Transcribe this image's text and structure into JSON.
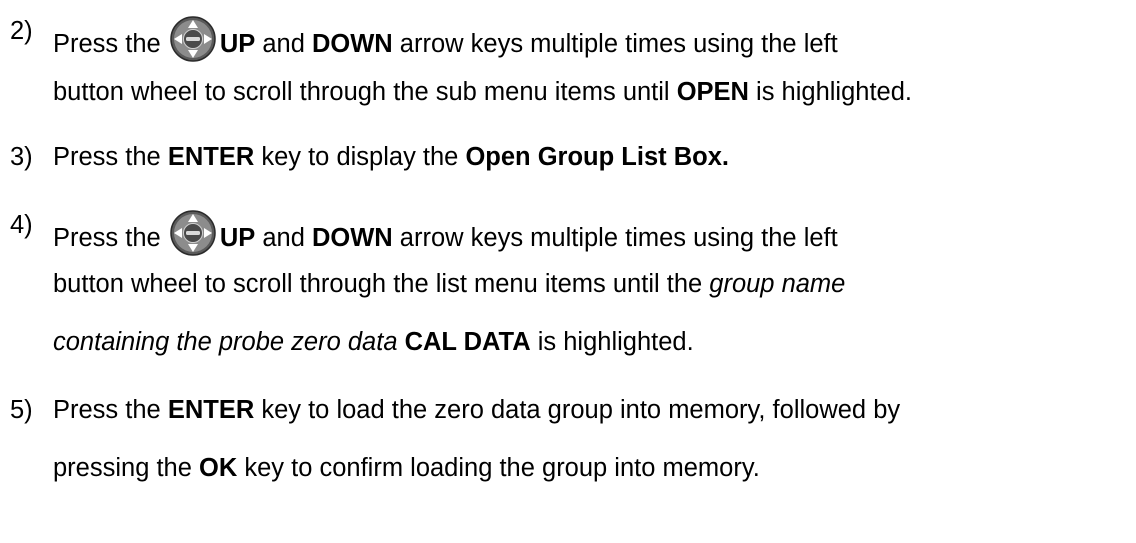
{
  "steps": [
    {
      "number": "2)",
      "lines": [
        {
          "a": "Press the ",
          "icon": "enter-arrow-pad-icon",
          "b1": "UP",
          "c": " and ",
          "b2": "DOWN",
          "d": " arrow keys multiple times using the left"
        },
        {
          "a": "button wheel to scroll through the sub menu items until ",
          "b1": "OPEN",
          "c": " is highlighted."
        }
      ]
    },
    {
      "number": "3)",
      "lines": [
        {
          "a": "Press the ",
          "b1": "ENTER",
          "c": " key to display the ",
          "b2": "Open Group List Box."
        }
      ]
    },
    {
      "number": "4)",
      "lines": [
        {
          "a": "Press the ",
          "icon": "enter-arrow-pad-icon",
          "b1": "UP",
          "c": " and ",
          "b2": "DOWN",
          "d": " arrow keys multiple times using the left"
        },
        {
          "a": "button wheel to scroll through the list menu items until the ",
          "i1": "group name"
        },
        {
          "i1": "containing the probe zero data",
          "b1": " CAL DATA",
          "c": " is highlighted."
        }
      ]
    },
    {
      "number": "5)",
      "lines": [
        {
          "a": "Press the ",
          "b1": "ENTER",
          "c": " key to load the zero data group into memory, followed by"
        },
        {
          "a": "pressing the ",
          "b1": "OK",
          "c": " key to confirm loading the group into memory."
        }
      ]
    }
  ],
  "icon_labels": {
    "center": "ENTER"
  }
}
